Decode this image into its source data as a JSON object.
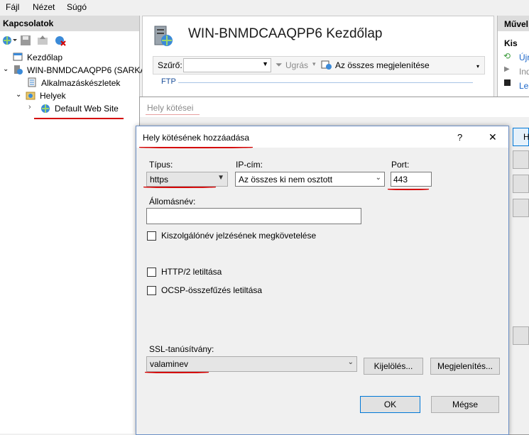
{
  "menubar": {
    "items": [
      "Fájl",
      "Nézet",
      "Súgó"
    ]
  },
  "connections": {
    "header": "Kapcsolatok",
    "tree": [
      {
        "label": "Kezdőlap"
      },
      {
        "label": "WIN-BNMDCAAQPP6 (SARKA"
      },
      {
        "label": "Alkalmazáskészletek"
      },
      {
        "label": "Helyek"
      },
      {
        "label": "Default Web Site"
      }
    ]
  },
  "center": {
    "title": "WIN-BNMDCAAQPP6 Kezdőlap",
    "filter_label": "Szűrő:",
    "go_label": "Ugrás",
    "show_all_label": "Az összes megjelenítése",
    "group_label": "FTP"
  },
  "actions": {
    "header": "Művel",
    "sub_header": "Kis",
    "items": [
      "Újr",
      "Ind",
      "Lea"
    ],
    "side_button": "H"
  },
  "site_bindings": {
    "title": "Hely kötései"
  },
  "add_binding": {
    "title": "Hely kötésének hozzáadása",
    "help": "?",
    "close": "✕",
    "type_label": "Típus:",
    "type_value": "https",
    "ip_label": "IP-cím:",
    "ip_value": "Az összes ki nem osztott",
    "port_label": "Port:",
    "port_value": "443",
    "hostname_label": "Állomásnév:",
    "hostname_value": "",
    "require_sni_label": "Kiszolgálónév jelzésének megkövetelése",
    "disable_http2_label": "HTTP/2 letiltása",
    "disable_ocsp_label": "OCSP-összefűzés letiltása",
    "ssl_label": "SSL-tanúsítvány:",
    "ssl_value": "valaminev",
    "select_button": "Kijelölés...",
    "view_button": "Megjelenítés...",
    "ok_button": "OK",
    "cancel_button": "Mégse"
  }
}
